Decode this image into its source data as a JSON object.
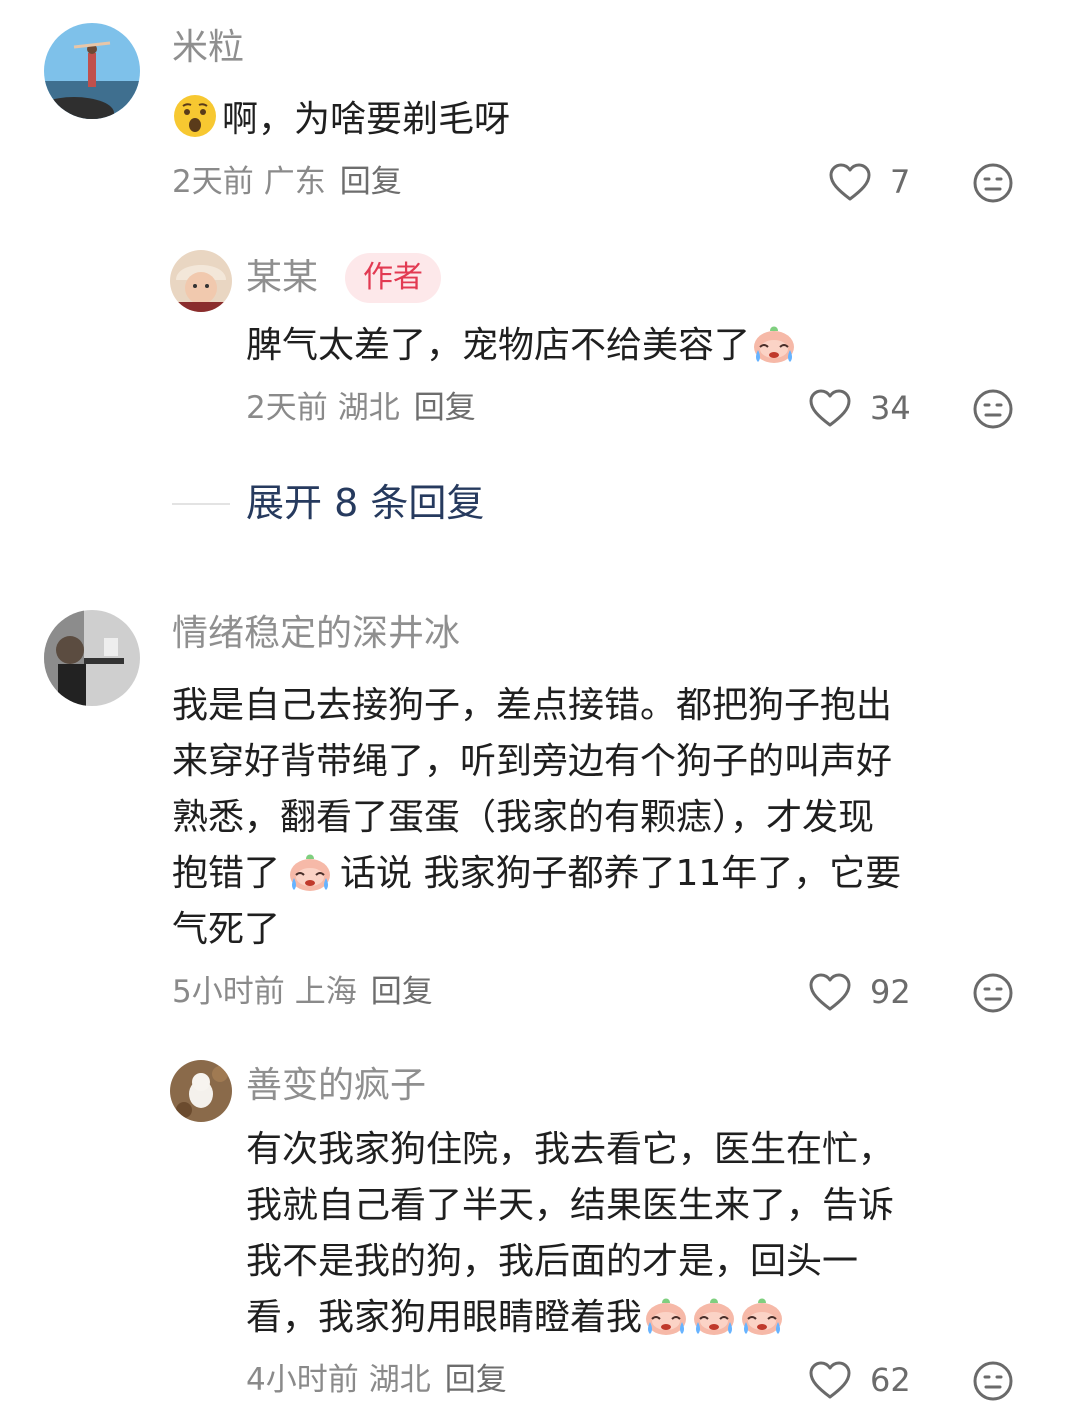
{
  "comments": [
    {
      "name": "米粒",
      "text": "啊，为啥要剃毛呀",
      "time": "2天前",
      "location": "广东",
      "reply_label": "回复",
      "likes": "7",
      "leading_emoji": "astonished-face-icon"
    },
    {
      "name": "情绪稳定的深井冰",
      "text_lines": [
        "我是自己去接狗子，差点接错。都把狗子抱出",
        "来穿好背带绳了，听到旁边有个狗子的叫声好",
        "熟悉，翻看了蛋蛋（我家的有颗痣），才发现",
        "抱错了",
        "话说 我家狗子都养了11年了，它要",
        "气死了"
      ],
      "time": "5小时前",
      "location": "上海",
      "reply_label": "回复",
      "likes": "92"
    }
  ],
  "replies": [
    {
      "name": "某某",
      "badge": "作者",
      "text": "脾气太差了，宠物店不给美容了",
      "time": "2天前",
      "location": "湖北",
      "reply_label": "回复",
      "likes": "34",
      "trailing_emoji": "crying-face-icon"
    },
    {
      "name": "善变的疯子",
      "text_lines": [
        "有次我家狗住院，我去看它，医生在忙，",
        "我就自己看了半天，结果医生来了，告诉",
        "我不是我的狗，我后面的才是，回头一",
        "看，我家狗用眼睛瞪着我"
      ],
      "time": "4小时前",
      "location": "湖北",
      "reply_label": "回复",
      "likes": "62",
      "trailing_emoji_count": 3
    }
  ],
  "expand_replies": "展开 8 条回复",
  "colors": {
    "accent_badge_bg": "#fde8ea",
    "accent_badge_text": "#e23a52",
    "expand_text": "#263a5e",
    "meta_text": "#8a8a8a"
  }
}
